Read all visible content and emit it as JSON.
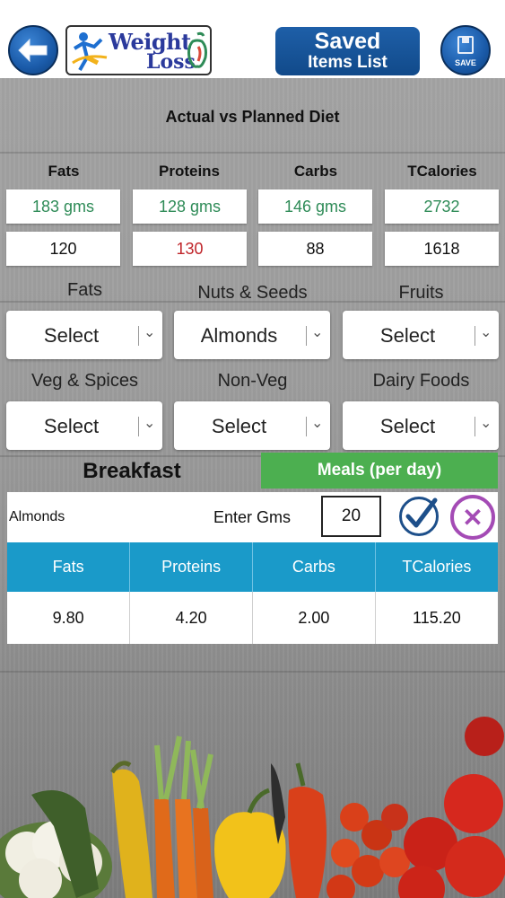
{
  "header": {
    "logo_line1": "Weight",
    "logo_line2": "Loss",
    "saved_line1": "Saved",
    "saved_line2": "Items List",
    "save_label": "SAVE"
  },
  "summary": {
    "title": "Actual vs Planned Diet",
    "columns": [
      "Fats",
      "Proteins",
      "Carbs",
      "TCalories"
    ],
    "actual": [
      "183 gms",
      "128 gms",
      "146 gms",
      "2732"
    ],
    "planned": [
      "120",
      "130",
      "88",
      "1618"
    ]
  },
  "categories": [
    {
      "label": "Fats",
      "selected": "Select"
    },
    {
      "label": "Nuts & Seeds",
      "selected": "Almonds"
    },
    {
      "label": "Fruits",
      "selected": "Select"
    },
    {
      "label": "Veg & Spices",
      "selected": "Select"
    },
    {
      "label": "Non-Veg",
      "selected": "Select"
    },
    {
      "label": "Dairy Foods",
      "selected": "Select"
    }
  ],
  "meal": {
    "name": "Breakfast",
    "meals_button": "Meals (per day)"
  },
  "entry": {
    "food": "Almonds",
    "grams_label": "Enter Gms",
    "grams_value": "20"
  },
  "result": {
    "headers": [
      "Fats",
      "Proteins",
      "Carbs",
      "TCalories"
    ],
    "values": [
      "9.80",
      "4.20",
      "2.00",
      "115.20"
    ]
  },
  "colors": {
    "actual_text": "#2e8b57",
    "over_text": "#c0262b",
    "accent_blue": "#1a9ac9",
    "meals_green": "#4caf50"
  }
}
